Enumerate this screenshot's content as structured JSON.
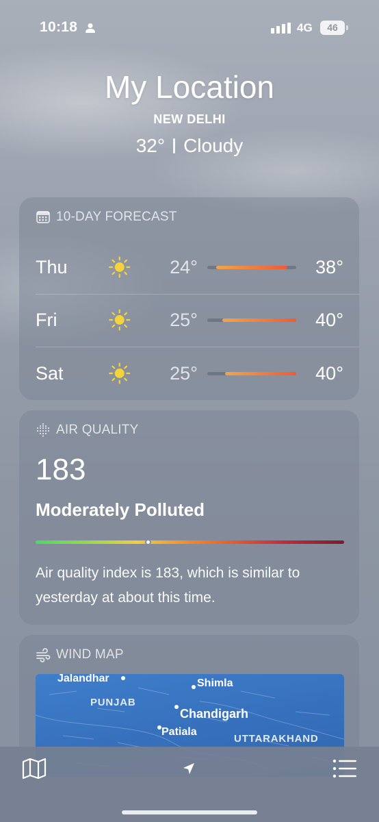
{
  "status": {
    "time": "10:18",
    "network": "4G",
    "battery": "46"
  },
  "header": {
    "title": "My Location",
    "subtitle": "NEW DELHI",
    "temperature": "32°",
    "condition": "Cloudy"
  },
  "forecast": {
    "title": "10-DAY FORECAST",
    "icon": "calendar-icon",
    "days": [
      {
        "day": "Thu",
        "icon": "sun-icon",
        "low": "24°",
        "high": "38°",
        "bar_start": 0.1,
        "bar_end": 0.9
      },
      {
        "day": "Fri",
        "icon": "sun-icon",
        "low": "25°",
        "high": "40°",
        "bar_start": 0.17,
        "bar_end": 1.0
      },
      {
        "day": "Sat",
        "icon": "sun-icon",
        "low": "25°",
        "high": "40°",
        "bar_start": 0.2,
        "bar_end": 1.0
      }
    ]
  },
  "air_quality": {
    "title": "AIR QUALITY",
    "icon": "air-quality-icon",
    "value": "183",
    "status": "Moderately Polluted",
    "scale_position": 0.365,
    "description": "Air quality index is 183, which is similar to yesterday at about this time."
  },
  "wind_map": {
    "title": "WIND MAP",
    "icon": "wind-icon",
    "labels": {
      "jalandhar": "Jalandhar",
      "shimla": "Shimla",
      "punjab": "PUNJAB",
      "chandigarh": "Chandigarh",
      "patiala": "Patiala",
      "uttarakhand": "UTTARAKHAND"
    }
  },
  "tab_bar": {
    "map": "map-icon",
    "location": "location-arrow-icon",
    "list": "list-icon"
  },
  "colors": {
    "map_blue": "#3771bd",
    "forecast_bar_start": "#f0a54a",
    "forecast_bar_end": "#ef5a36",
    "sun": "#f5d33a"
  }
}
